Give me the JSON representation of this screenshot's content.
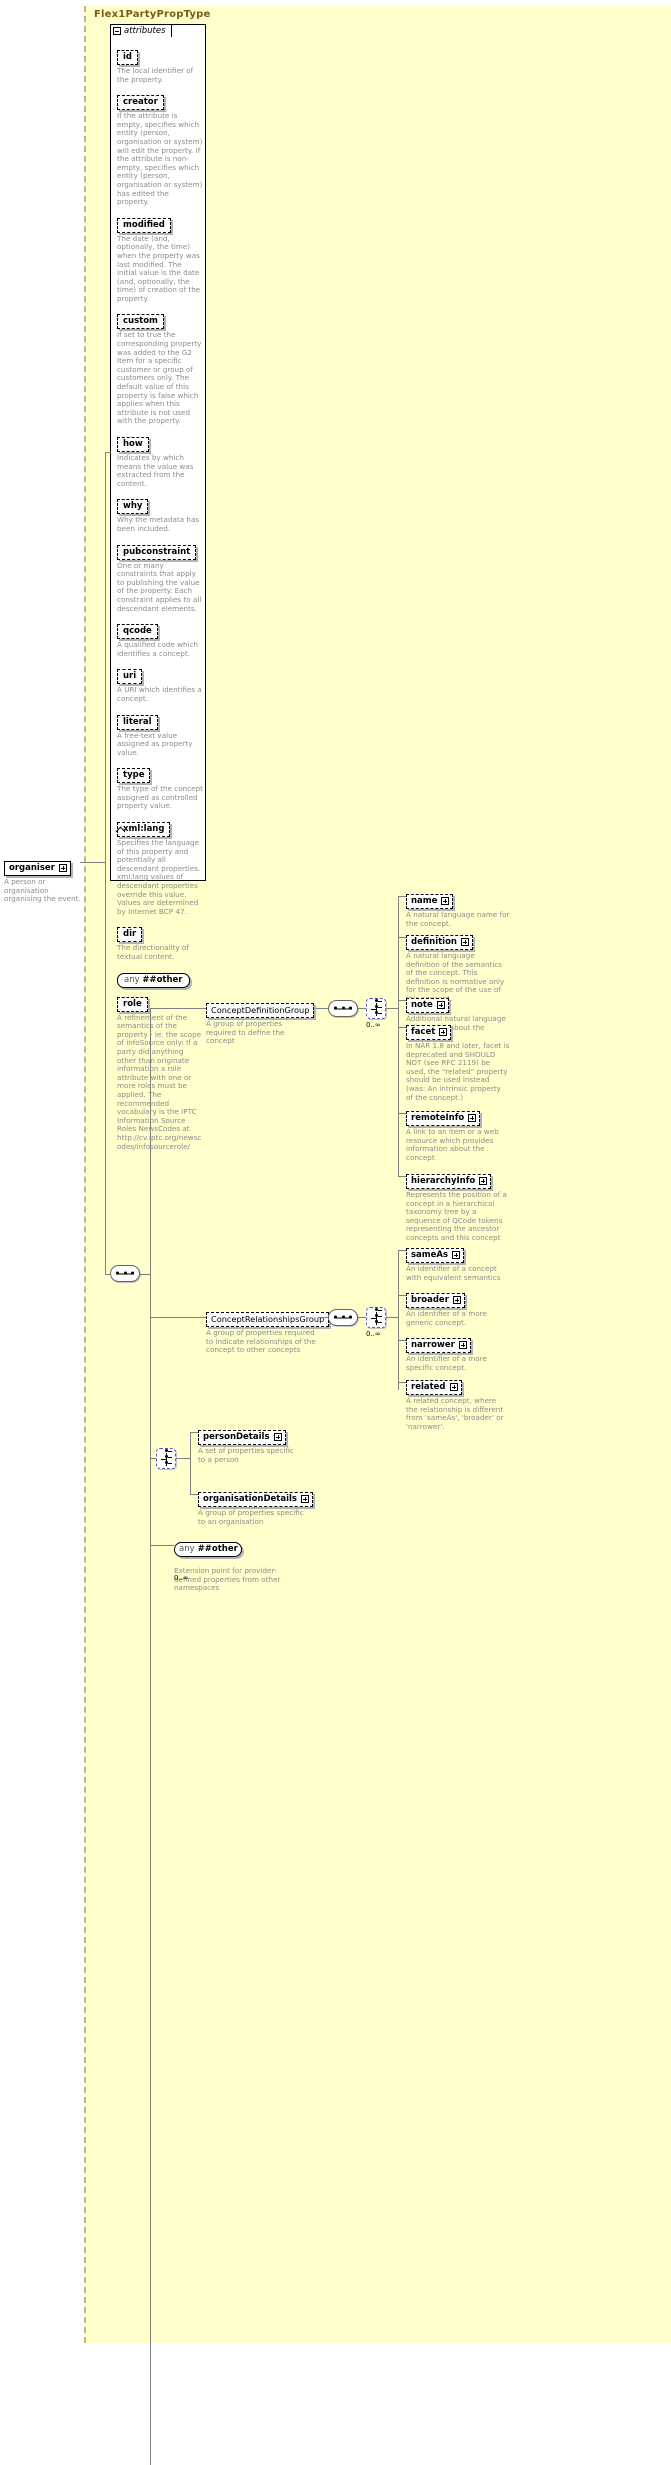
{
  "diagram": {
    "type_name": "Flex1PartyPropType",
    "attributes_label": "attributes",
    "accent_bg": "#ffffcc",
    "desc_color": "#8c8c8c"
  },
  "attributes": [
    {
      "name": "id",
      "desc": "The local identifier of the property."
    },
    {
      "name": "creator",
      "desc": "If the attribute is empty, specifies which entity (person, organisation or system) will edit the property. If the attribute is non-empty, specifies which entity (person, organisation or system) has edited the property."
    },
    {
      "name": "modified",
      "desc": "The date (and, optionally, the time) when the property was last modified. The initial value is the date (and, optionally, the time) of creation of the property."
    },
    {
      "name": "custom",
      "desc": "If set to true the corresponding property was added to the G2 Item for a specific customer or group of customers only. The default value of this property is false which applies when this attribute is not used with the property."
    },
    {
      "name": "how",
      "desc": "Indicates by which means the value was extracted from the content."
    },
    {
      "name": "why",
      "desc": "Why the metadata has been included."
    },
    {
      "name": "pubconstraint",
      "desc": "One or many constraints that apply to publishing the value of the property. Each constraint applies to all descendant elements."
    },
    {
      "name": "qcode",
      "desc": "A qualified code which identifies a concept."
    },
    {
      "name": "uri",
      "desc": "A URI which identifies a concept."
    },
    {
      "name": "literal",
      "desc": "A free-text value assigned as property value."
    },
    {
      "name": "type",
      "desc": "The type of the concept assigned as controlled property value."
    },
    {
      "name": "xml:lang",
      "desc": "Specifies the language of this property and potentially all descendant properties. xml:lang values of descendant properties override this value. Values are determined by Internet BCP 47.",
      "arrow": true
    },
    {
      "name": "dir",
      "desc": "The directionality of textual content."
    },
    {
      "name": "any ##other",
      "any": true,
      "prefix": "any",
      "wildcard": "##other",
      "desc": ""
    },
    {
      "name": "role",
      "desc": "A refinement of the semantics of the property - ie. the scope of infoSource only: If a party did anything other than originate information a role attribute with one or more roles must be applied. The recommended vocabulary is the IPTC Information Source Roles NewsCodes at http://cv.iptc.org/newscodes/infosourcerole/"
    }
  ],
  "root_element": {
    "name": "organiser",
    "desc": "A person or organisation organising the event."
  },
  "groups": [
    {
      "name": "ConceptDefinitionGroup",
      "desc": "A group of properties required to define the concept",
      "occurs": "0..∞",
      "children": [
        {
          "name": "name",
          "desc": "A natural language name for the concept."
        },
        {
          "name": "definition",
          "desc": "A natural language definition of the semantics of the concept. This definition is normative only for the scope of the use of this concept."
        },
        {
          "name": "note",
          "desc": "Additional natural language information about the concept."
        },
        {
          "name": "facet",
          "desc": "In NAR 1.8 and later, facet is deprecated and SHOULD NOT (see RFC 2119) be used, the “related” property should be used instead (was: An intrinsic property of the concept.)"
        },
        {
          "name": "remoteInfo",
          "desc": "A link to an item or a web resource which provides information about the concept"
        },
        {
          "name": "hierarchyInfo",
          "desc": "Represents the position of a concept in a hierarchical taxonomy tree by a sequence of QCode tokens representing the ancestor concepts and this concept"
        }
      ]
    },
    {
      "name": "ConceptRelationshipsGroup",
      "desc": "A group of properties required to indicate relationships of the concept to other concepts",
      "occurs": "0..∞",
      "children": [
        {
          "name": "sameAs",
          "desc": "An identifier of a concept with equivalent semantics"
        },
        {
          "name": "broader",
          "desc": "An identifier of a more generic concept."
        },
        {
          "name": "narrower",
          "desc": "An identifier of a more specific concept."
        },
        {
          "name": "related",
          "desc": "A related concept, where the relationship is different from 'sameAs', 'broader' or 'narrower'."
        }
      ]
    }
  ],
  "detail_choice": {
    "children": [
      {
        "name": "personDetails",
        "desc": "A set of properties specific to a person"
      },
      {
        "name": "organisationDetails",
        "desc": "A group of properties specific to an organisation"
      }
    ]
  },
  "any_extension": {
    "prefix": "any",
    "wildcard": "##other",
    "occurs": "0..∞",
    "desc": "Extension point for provider-defined properties from other namespaces"
  }
}
